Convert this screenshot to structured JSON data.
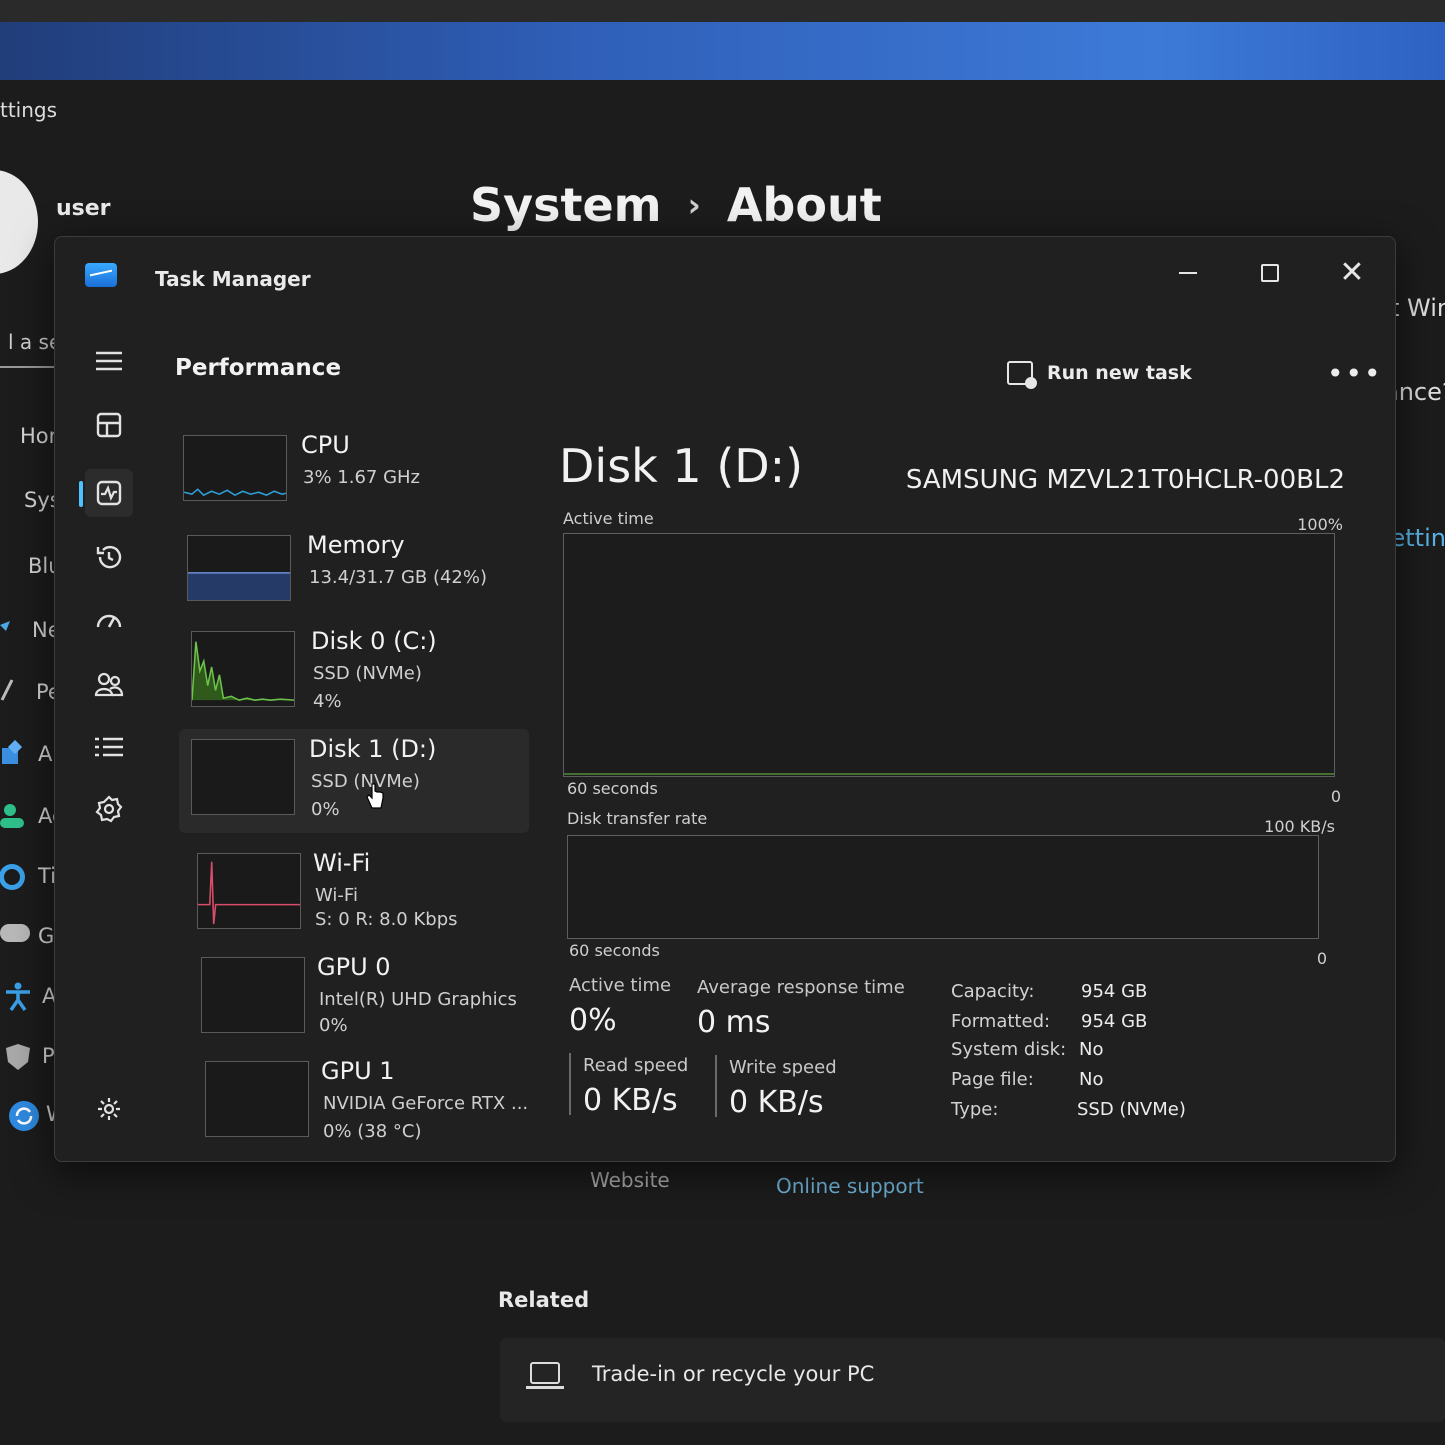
{
  "settings": {
    "window_title_fragment": "ttings",
    "user_name": "user",
    "breadcrumb": {
      "section": "System",
      "separator": "›",
      "page": "About"
    },
    "search_fragment": "l a set",
    "nav_items": [
      {
        "label": "Hom",
        "icon": "home-icon"
      },
      {
        "label": "Syst",
        "icon": "system-icon"
      },
      {
        "label": "Blue",
        "icon": "bluetooth-icon"
      },
      {
        "label": "Netv",
        "icon": "network-icon"
      },
      {
        "label": "Pers",
        "icon": "personalization-icon"
      },
      {
        "label": "App",
        "icon": "apps-icon"
      },
      {
        "label": "Acc",
        "icon": "accounts-icon"
      },
      {
        "label": "Time",
        "icon": "time-icon"
      },
      {
        "label": "Gam",
        "icon": "gaming-icon"
      },
      {
        "label": "Acc",
        "icon": "accessibility-icon"
      },
      {
        "label": "Priv",
        "icon": "privacy-icon"
      },
      {
        "label": "Win",
        "icon": "windows-update-icon"
      }
    ],
    "right_peek": {
      "line1": "t Win",
      "line2": "ance?",
      "link": "setting"
    },
    "support_links": {
      "website": "Website",
      "online_support": "Online support"
    },
    "related": {
      "title": "Related",
      "card_label": "Trade-in or recycle your PC"
    }
  },
  "task_manager": {
    "title": "Task Manager",
    "page_title": "Performance",
    "run_new_task": "Run new task",
    "more_label": "•••",
    "rail_icons": [
      "hamburger-icon",
      "processes-icon",
      "performance-icon",
      "app-history-icon",
      "startup-icon",
      "users-icon",
      "details-icon",
      "services-icon",
      "settings-icon"
    ],
    "devices": [
      {
        "name": "CPU",
        "line2": "3%  1.67 GHz",
        "line3": "",
        "color": "#2f9fd8"
      },
      {
        "name": "Memory",
        "line2": "13.4/31.7 GB (42%)",
        "line3": "",
        "color": "#6b8fd6"
      },
      {
        "name": "Disk 0 (C:)",
        "line2": "SSD (NVMe)",
        "line3": "4%",
        "color": "#6cc24a"
      },
      {
        "name": "Disk 1 (D:)",
        "line2": "SSD (NVMe)",
        "line3": "0%",
        "color": "#6cc24a"
      },
      {
        "name": "Wi-Fi",
        "line2": "Wi-Fi",
        "line3": "S: 0  R: 8.0 Kbps",
        "color": "#d94c6a"
      },
      {
        "name": "GPU 0",
        "line2": "Intel(R) UHD Graphics",
        "line3": "0%",
        "color": "#2f9fd8"
      },
      {
        "name": "GPU 1",
        "line2": "NVIDIA GeForce RTX ...",
        "line3": "0%  (38 °C)",
        "color": "#2f9fd8"
      }
    ],
    "detail": {
      "title": "Disk 1 (D:)",
      "model": "SAMSUNG MZVL21T0HCLR-00BL2",
      "active_chart": {
        "label": "Active time",
        "max": "100%",
        "span": "60 seconds",
        "min": "0"
      },
      "transfer_chart": {
        "label": "Disk transfer rate",
        "max": "100 KB/s",
        "span": "60 seconds",
        "min": "0"
      },
      "stats": {
        "active_time_label": "Active time",
        "active_time_value": "0%",
        "avg_response_label": "Average response time",
        "avg_response_value": "0 ms",
        "read_label": "Read speed",
        "read_value": "0 KB/s",
        "write_label": "Write speed",
        "write_value": "0 KB/s"
      },
      "properties": [
        {
          "key": "Capacity:",
          "value": "954 GB"
        },
        {
          "key": "Formatted:",
          "value": "954 GB"
        },
        {
          "key": "System disk:",
          "value": "No"
        },
        {
          "key": "Page file:",
          "value": "No"
        },
        {
          "key": "Type:",
          "value": "SSD (NVMe)"
        }
      ]
    }
  }
}
